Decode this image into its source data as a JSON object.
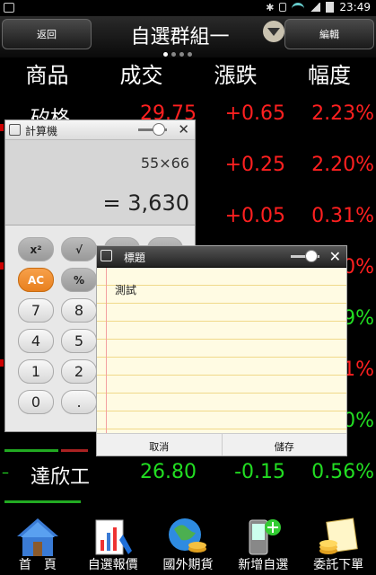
{
  "status_bar": {
    "time": "23:49"
  },
  "header": {
    "back_label": "返回",
    "title": "自選群組一",
    "edit_label": "編輯"
  },
  "columns": [
    "商品",
    "成交",
    "漲跌",
    "幅度"
  ],
  "rows": [
    {
      "name": "矽格",
      "price": "29.75",
      "change": "+0.65",
      "pct": "2.23%"
    },
    {
      "name": "",
      "price": "",
      "change": "+0.25",
      "pct": "2.20%"
    },
    {
      "name": "",
      "price": "",
      "change": "+0.05",
      "pct": "0.31%"
    },
    {
      "name": "",
      "price": "",
      "change": "",
      "pct": "0%"
    },
    {
      "name": "",
      "price": "",
      "change": "",
      "pct": "9%"
    },
    {
      "name": "",
      "price": "",
      "change": "",
      "pct": "1%"
    },
    {
      "name": "",
      "price": "",
      "change": "",
      "pct": "0%"
    },
    {
      "name": "達欣工",
      "price": "26.80",
      "change": "-0.15",
      "pct": "0.56%"
    }
  ],
  "calculator": {
    "title": "計算機",
    "expression": "55×66",
    "result": "= 3,630",
    "keys": [
      [
        "x²",
        "√",
        "",
        ""
      ],
      [
        "AC",
        "%",
        "",
        ""
      ],
      [
        "7",
        "8",
        "",
        ""
      ],
      [
        "4",
        "5",
        "",
        ""
      ],
      [
        "1",
        "2",
        "",
        ""
      ],
      [
        "0",
        ".",
        "",
        ""
      ]
    ]
  },
  "notes": {
    "title": "標題",
    "text": "測試",
    "cancel_label": "取消",
    "save_label": "儲存"
  },
  "bottom_nav": [
    {
      "label": "首　頁",
      "icon": "home-icon"
    },
    {
      "label": "自選報價",
      "icon": "chart-report-icon"
    },
    {
      "label": "國外期貨",
      "icon": "globe-coins-icon"
    },
    {
      "label": "新增自選",
      "icon": "phone-add-icon"
    },
    {
      "label": "委託下單",
      "icon": "order-coins-icon"
    }
  ],
  "colors": {
    "up": "#ff2020",
    "down": "#22dd22"
  }
}
